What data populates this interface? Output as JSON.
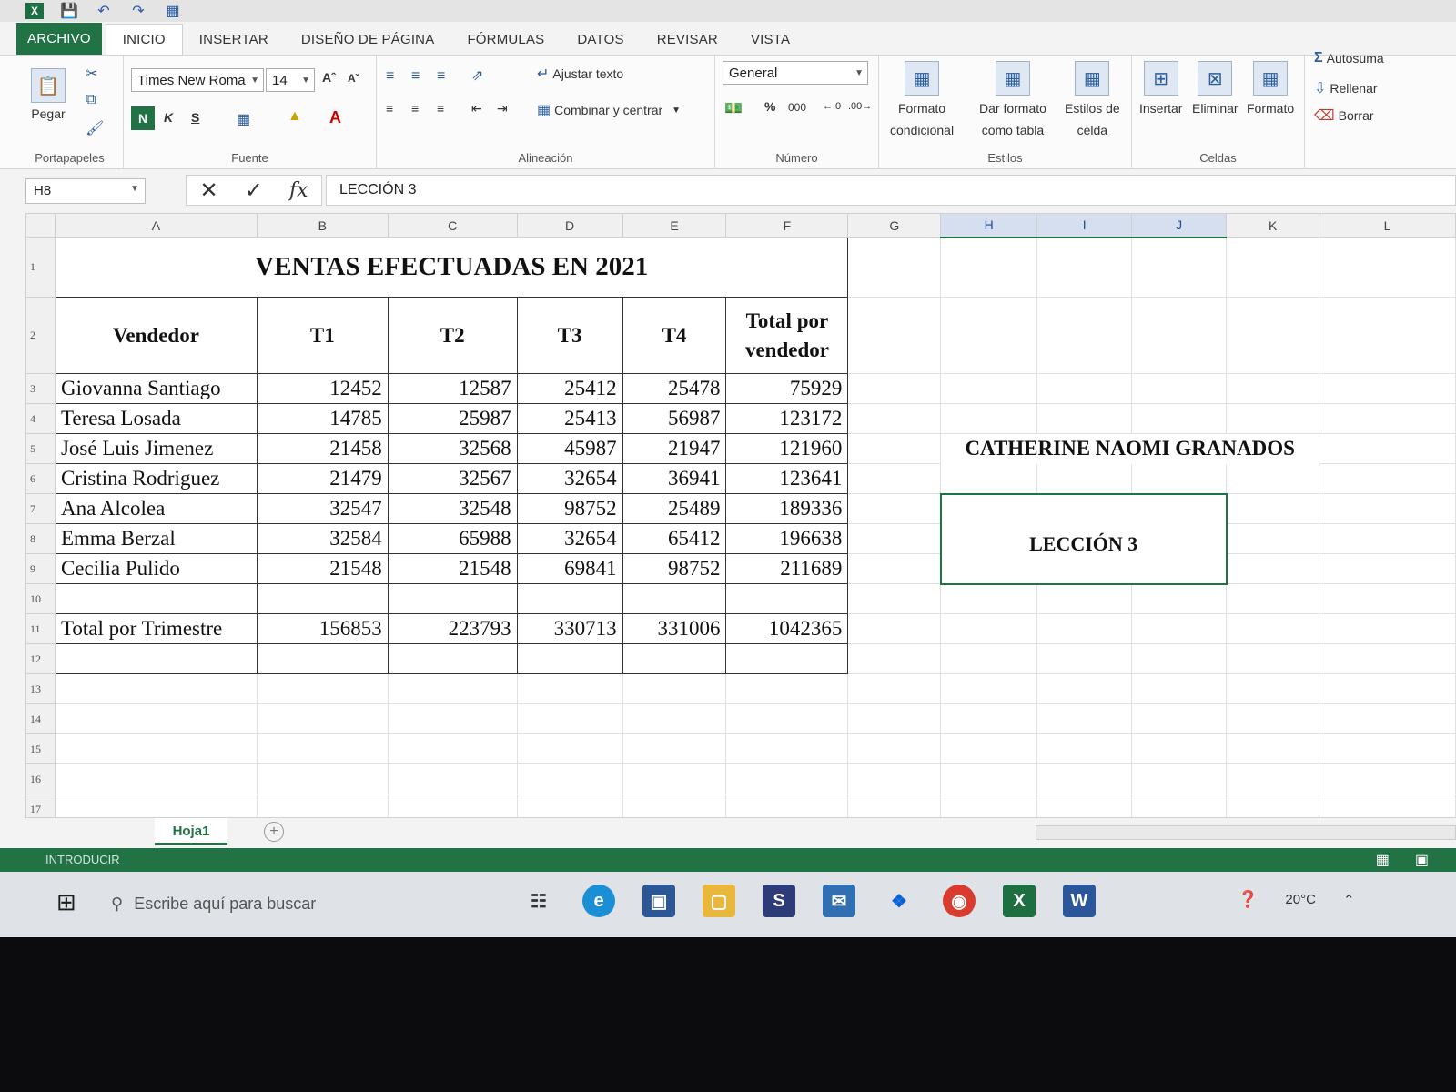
{
  "ribbon": {
    "tabs": [
      "ARCHIVO",
      "INICIO",
      "INSERTAR",
      "DISEÑO DE PÁGINA",
      "FÓRMULAS",
      "DATOS",
      "REVISAR",
      "VISTA"
    ],
    "clipboard": {
      "paste": "Pegar",
      "group": "Portapapeles"
    },
    "font": {
      "family": "Times New Roma",
      "size": "14",
      "bold": "N",
      "italic": "K",
      "underline": "S",
      "group": "Fuente"
    },
    "alignment": {
      "wrap": "Ajustar texto",
      "merge": "Combinar y centrar",
      "group": "Alineación"
    },
    "number": {
      "format": "General",
      "percent": "%",
      "thousands": "000",
      "group": "Número"
    },
    "styles": {
      "conditional": [
        "Formato",
        "condicional"
      ],
      "table": [
        "Dar formato",
        "como tabla"
      ],
      "cell": [
        "Estilos de",
        "celda"
      ],
      "group": "Estilos"
    },
    "cells": {
      "insert": "Insertar",
      "delete": "Eliminar",
      "format": "Formato",
      "group": "Celdas"
    },
    "editing": {
      "autosum": "Autosuma",
      "fill": "Rellenar",
      "clear": "Borrar"
    }
  },
  "formula_bar": {
    "name_box": "H8",
    "content": "LECCIÓN 3"
  },
  "columns": [
    "A",
    "B",
    "C",
    "D",
    "E",
    "F",
    "G",
    "H",
    "I",
    "J",
    "K",
    "L"
  ],
  "sheet": {
    "title": "VENTAS EFECTUADAS EN 2021",
    "headers": [
      "Vendedor",
      "T1",
      "T2",
      "T3",
      "T4",
      "Total por vendedor"
    ],
    "rows": [
      {
        "name": "Giovanna Santiago",
        "values": [
          "12452",
          "12587",
          "25412",
          "25478",
          "75929"
        ]
      },
      {
        "name": "Teresa Losada",
        "values": [
          "14785",
          "25987",
          "25413",
          "56987",
          "123172"
        ]
      },
      {
        "name": "José Luis Jimenez",
        "values": [
          "21458",
          "32568",
          "45987",
          "21947",
          "121960"
        ]
      },
      {
        "name": "Cristina Rodriguez",
        "values": [
          "21479",
          "32567",
          "32654",
          "36941",
          "123641"
        ]
      },
      {
        "name": "Ana Alcolea",
        "values": [
          "32547",
          "32548",
          "98752",
          "25489",
          "189336"
        ]
      },
      {
        "name": "Emma Berzal",
        "values": [
          "32584",
          "65988",
          "32654",
          "65412",
          "196638"
        ]
      },
      {
        "name": "Cecilia Pulido",
        "values": [
          "21548",
          "21548",
          "69841",
          "98752",
          "211689"
        ]
      }
    ],
    "totals": {
      "label": "Total por Trimestre",
      "values": [
        "156853",
        "223793",
        "330713",
        "331006",
        "1042365"
      ]
    },
    "author": "CATHERINE NAOMI GRANADOS",
    "lesson": "LECCIÓN 3"
  },
  "sheet_tab": "Hoja1",
  "status": "INTRODUCIR",
  "taskbar": {
    "search_placeholder": "Escribe aquí para buscar",
    "temperature": "20°C"
  }
}
